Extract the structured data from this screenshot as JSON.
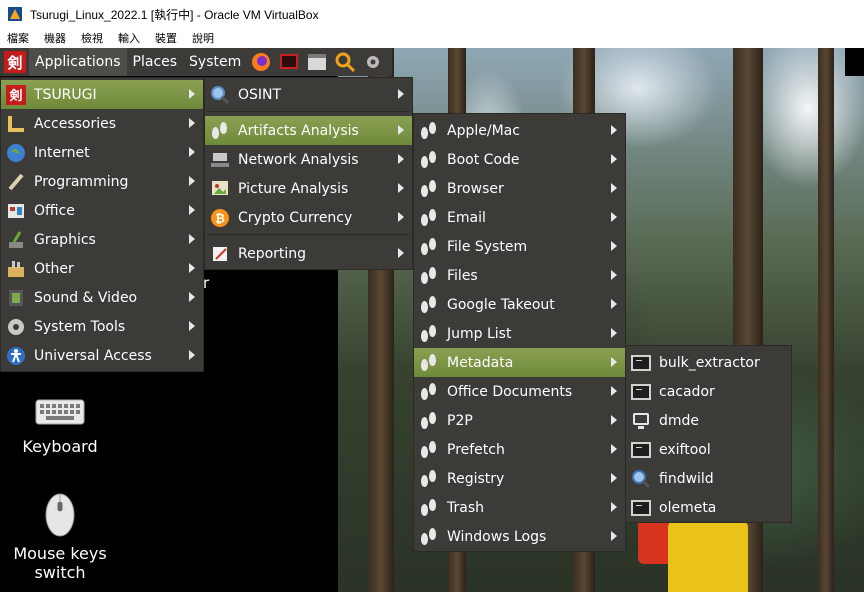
{
  "window": {
    "title": "Tsurugi_Linux_2022.1 [執行中] - Oracle VM VirtualBox",
    "menu": [
      "檔案",
      "機器",
      "檢視",
      "輸入",
      "裝置",
      "說明"
    ]
  },
  "panel": {
    "logo_text": "剣",
    "menus": [
      "Applications",
      "Places",
      "System"
    ],
    "launchers": [
      "firefox-icon",
      "terminal-red-icon",
      "window-icon",
      "search-icon",
      "gear-icon"
    ]
  },
  "menu_main": [
    {
      "label": "TSURUGI",
      "icon": "tsurugi-logo-icon"
    },
    {
      "label": "Accessories",
      "icon": "accessories-icon"
    },
    {
      "label": "Internet",
      "icon": "globe-icon"
    },
    {
      "label": "Programming",
      "icon": "brush-icon"
    },
    {
      "label": "Office",
      "icon": "office-icon"
    },
    {
      "label": "Graphics",
      "icon": "graphics-icon"
    },
    {
      "label": "Other",
      "icon": "other-icon"
    },
    {
      "label": "Sound & Video",
      "icon": "film-icon"
    },
    {
      "label": "System Tools",
      "icon": "gear-icon"
    },
    {
      "label": "Universal Access",
      "icon": "accessibility-icon"
    }
  ],
  "menu_tsurugi": [
    {
      "label": "OSINT",
      "icon": "magnifier-icon"
    },
    {
      "label": "Artifacts Analysis",
      "icon": "footprints-icon"
    },
    {
      "label": "Network Analysis",
      "icon": "network-icon"
    },
    {
      "label": "Picture Analysis",
      "icon": "picture-icon"
    },
    {
      "label": "Crypto Currency",
      "icon": "bitcoin-icon"
    },
    {
      "label": "Reporting",
      "icon": "report-icon"
    }
  ],
  "menu_artifacts": [
    {
      "label": "Apple/Mac"
    },
    {
      "label": "Boot Code"
    },
    {
      "label": "Browser"
    },
    {
      "label": "Email"
    },
    {
      "label": "File System"
    },
    {
      "label": "Files"
    },
    {
      "label": "Google Takeout"
    },
    {
      "label": "Jump List"
    },
    {
      "label": "Metadata"
    },
    {
      "label": "Office Documents"
    },
    {
      "label": "P2P"
    },
    {
      "label": "Prefetch"
    },
    {
      "label": "Registry"
    },
    {
      "label": "Trash"
    },
    {
      "label": "Windows Logs"
    }
  ],
  "menu_metadata": [
    {
      "label": "bulk_extractor",
      "icon": "terminal-icon"
    },
    {
      "label": "cacador",
      "icon": "terminal-icon"
    },
    {
      "label": "dmde",
      "icon": "monitor-icon"
    },
    {
      "label": "exiftool",
      "icon": "terminal-icon"
    },
    {
      "label": "findwild",
      "icon": "magnifier-icon"
    },
    {
      "label": "olemeta",
      "icon": "terminal-icon"
    }
  ],
  "desktop": {
    "keyboard_label": "Keyboard",
    "mouse_label": "Mouse keys switch",
    "partial_text": "r"
  },
  "colors": {
    "panel": "#3c3b37",
    "highlight": "#7a9544",
    "text": "#ffffff"
  }
}
